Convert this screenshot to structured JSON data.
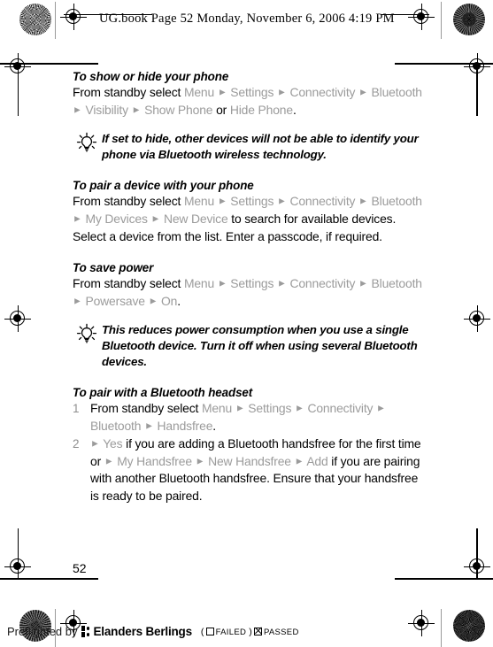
{
  "page": {
    "header_note": "UG.book  Page 52  Monday, November 6, 2006  4:19 PM",
    "page_number": "52"
  },
  "sections": [
    {
      "id": "show-hide-phone",
      "heading": "To show or hide your phone",
      "lead": "From standby select ",
      "path": [
        "Menu",
        "Settings",
        "Connectivity",
        "Bluetooth",
        "Visibility",
        "Show Phone"
      ],
      "conjunction": " or ",
      "alt_path": [
        "Hide Phone"
      ],
      "trailing": ".",
      "tip": "If set to hide, other devices will not be able to identify your phone via Bluetooth wireless technology.",
      "tip_icon": "lightbulb-icon"
    },
    {
      "id": "pair-device",
      "heading": "To pair a device with your phone",
      "lead": "From standby select ",
      "path": [
        "Menu",
        "Settings",
        "Connectivity",
        "Bluetooth",
        "My Devices",
        "New Device"
      ],
      "trailing": " to search for available devices. Select a device from the list. Enter a passcode, if required."
    },
    {
      "id": "save-power",
      "heading": "To save power",
      "lead": "From standby select ",
      "path": [
        "Menu",
        "Settings",
        "Connectivity",
        "Bluetooth",
        "Powersave",
        "On"
      ],
      "trailing": ".",
      "tip": "This reduces power consumption when you use a single Bluetooth device. Turn it off when using several Bluetooth devices.",
      "tip_icon": "lightbulb-icon"
    },
    {
      "id": "pair-headset",
      "heading": "To pair with a Bluetooth headset",
      "steps": [
        {
          "num": "1",
          "lead": "From standby select ",
          "path": [
            "Menu",
            "Settings",
            "Connectivity",
            "Bluetooth",
            "Handsfree"
          ],
          "trailing": "."
        },
        {
          "num": "2",
          "lead": "",
          "path_lead": [
            "Yes"
          ],
          "mid": " if you are adding a Bluetooth handsfree for the first time or ",
          "path": [
            "My Handsfree",
            "New Handsfree",
            "Add"
          ],
          "trailing": " if you are pairing with another Bluetooth handsfree. Ensure that your handsfree is ready to be paired."
        }
      ]
    }
  ],
  "footer": {
    "preflight_label": "Preflighted by",
    "brand": "Elanders Berlings",
    "open_paren": "(",
    "failed_label": "FAILED",
    "close_paren": ")",
    "passed_label": "PASSED"
  },
  "colors": {
    "menu_gray": "#9b9b9b",
    "text_black": "#000000",
    "rule_gray": "#9a9a9a"
  }
}
